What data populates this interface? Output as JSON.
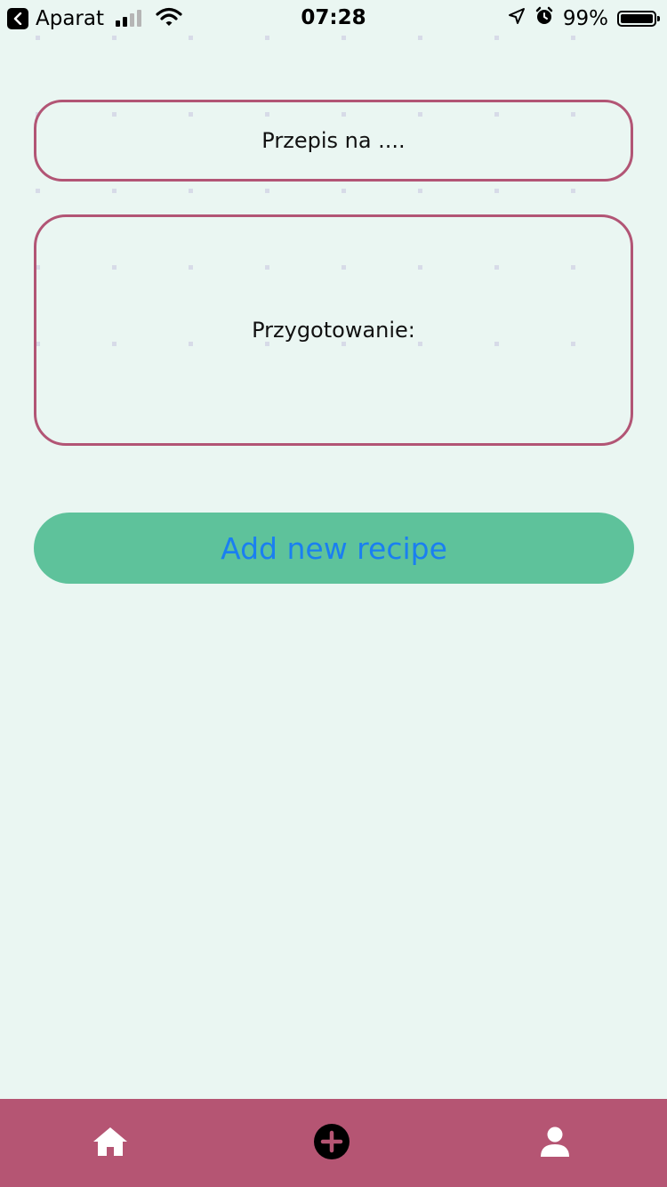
{
  "status_bar": {
    "back_app": "Aparat",
    "time": "07:28",
    "battery": "99%",
    "signal_bars": 4,
    "signal_filled": 2,
    "icons": [
      "back-icon",
      "signal-icon",
      "wifi-icon",
      "location-icon",
      "alarm-icon",
      "battery-icon"
    ]
  },
  "form": {
    "title_placeholder": "Przepis na ....",
    "preparation_placeholder": "Przygotowanie:"
  },
  "actions": {
    "add_label": "Add new recipe"
  },
  "tab_bar": {
    "items": [
      {
        "name": "home",
        "icon": "home-icon"
      },
      {
        "name": "add",
        "icon": "plus-circle-icon"
      },
      {
        "name": "profile",
        "icon": "user-icon"
      }
    ]
  },
  "colors": {
    "background": "#eaf6f2",
    "accent_border": "#b25575",
    "button_bg": "#5ec29b",
    "button_text": "#1a7ff1",
    "tab_bar_bg": "#b55573"
  }
}
